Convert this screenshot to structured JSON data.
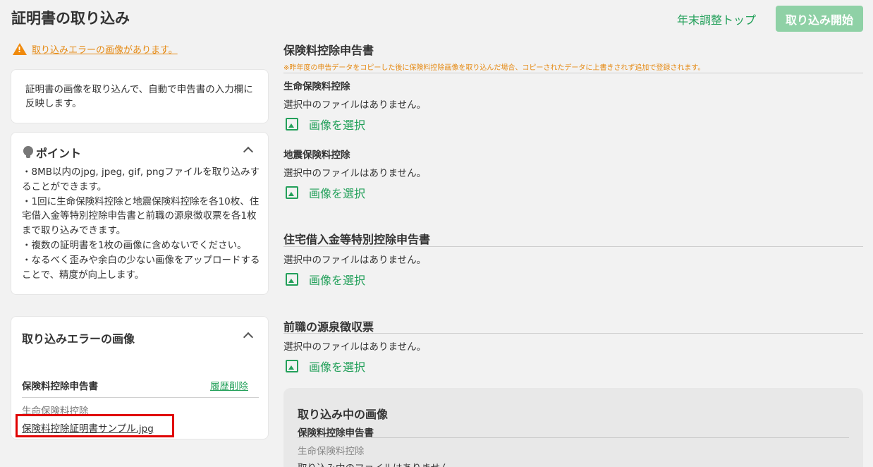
{
  "header": {
    "title": "証明書の取り込み",
    "top_link": "年末調整トップ",
    "start_button": "取り込み開始"
  },
  "warning": {
    "text": "取り込みエラーの画像があります。"
  },
  "description": {
    "text": "証明書の画像を取り込んで、自動で申告書の入力欄に反映します。"
  },
  "points": {
    "title": "ポイント",
    "text": "・8MB以内のjpg, jpeg, gif, pngファイルを取り込みすることができます。\n・1回に生命保険料控除と地震保険料控除を各10枚、住宅借入金等特別控除申告書と前職の源泉徴収票を各1枚まで取り込みできます。\n・複数の証明書を1枚の画像に含めないでください。\n・なるべく歪みや余白の少ない画像をアップロードすることで、精度が向上します。"
  },
  "error_images": {
    "title": "取り込みエラーの画像",
    "section": "保険料控除申告書",
    "clear_history": "履歴削除",
    "category": "生命保険料控除",
    "file": "保険料控除証明書サンプル.jpg"
  },
  "insurance": {
    "title": "保険料控除申告書",
    "note": "※昨年度の申告データをコピーした後に保険料控除画像を取り込んだ場合、コピーされたデータに上書きされず追加で登録されます。",
    "life": {
      "label": "生命保険料控除",
      "no_file": "選択中のファイルはありません。",
      "choose": "画像を選択"
    },
    "earthquake": {
      "label": "地震保険料控除",
      "no_file": "選択中のファイルはありません。",
      "choose": "画像を選択"
    }
  },
  "housing": {
    "title": "住宅借入金等特別控除申告書",
    "no_file": "選択中のファイルはありません。",
    "choose": "画像を選択"
  },
  "withholding": {
    "title": "前職の源泉徴収票",
    "no_file": "選択中のファイルはありません。",
    "choose": "画像を選択"
  },
  "processing": {
    "title": "取り込み中の画像",
    "section": "保険料控除申告書",
    "category": "生命保険料控除",
    "no_file": "取り込み中のファイルはありません。"
  },
  "icons": [
    "warning-icon",
    "lightbulb-icon",
    "chevron-up-icon",
    "image-icon"
  ],
  "colors": {
    "accent_green": "#23a05a",
    "start_button_bg": "#8fd1a6",
    "warning_orange": "#e58a14",
    "highlight_red": "#e00000"
  }
}
